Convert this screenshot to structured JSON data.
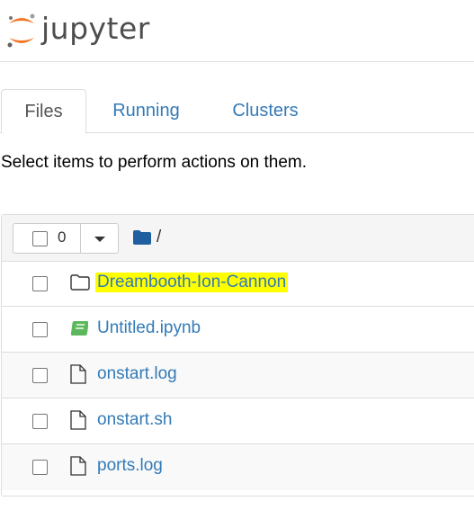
{
  "app": {
    "logo_text": "jupyter",
    "logo_accent": "#f37726"
  },
  "tabs": [
    {
      "label": "Files",
      "active": true
    },
    {
      "label": "Running",
      "active": false
    },
    {
      "label": "Clusters",
      "active": false
    }
  ],
  "instructions": "Select items to perform actions on them.",
  "toolbar": {
    "selected_count": "0",
    "breadcrumb_path": "/",
    "folder_icon": "folder-icon"
  },
  "files": [
    {
      "name": "Dreambooth-Ion-Cannon",
      "icon": "folder-outline-icon",
      "highlighted": true
    },
    {
      "name": "Untitled.ipynb",
      "icon": "notebook-icon",
      "highlighted": false
    },
    {
      "name": "onstart.log",
      "icon": "file-icon",
      "highlighted": false
    },
    {
      "name": "onstart.sh",
      "icon": "file-icon",
      "highlighted": false
    },
    {
      "name": "ports.log",
      "icon": "file-icon",
      "highlighted": false
    }
  ],
  "colors": {
    "link": "#337ab7",
    "highlight": "#ffff00",
    "notebook_green": "#5cb85c",
    "folder_blue": "#1f5f9f"
  }
}
